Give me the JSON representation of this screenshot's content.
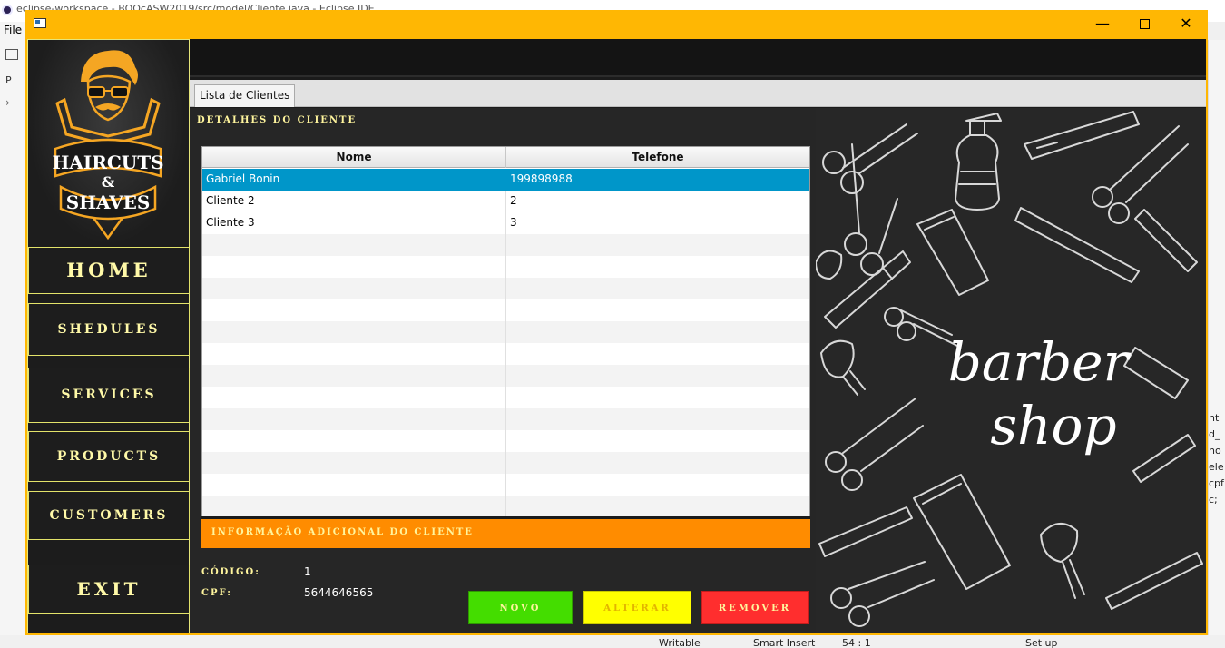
{
  "ide": {
    "title": "eclipse-workspace - BOOcASW2019/src/model/Cliente.java - Eclipse IDE",
    "menu_file": "File",
    "left_label": "P",
    "right_fragments": [
      "nt",
      "d_",
      "ho",
      "ele",
      "cpf",
      "c;"
    ],
    "status": {
      "writable": "Writable",
      "insert_mode": "Smart Insert",
      "position": "54 : 1",
      "extra": "Set up"
    }
  },
  "window": {
    "title_bar_color": "#ffb703",
    "controls": {
      "minimize": "—",
      "close": "✕"
    }
  },
  "sidebar": {
    "logo": {
      "line1": "HAIRCUTS",
      "line2": "&",
      "line3": "SHAVES"
    },
    "items": [
      {
        "label": "HOME"
      },
      {
        "label": "SHEDULES"
      },
      {
        "label": "SERVICES"
      },
      {
        "label": "PRODUCTS"
      },
      {
        "label": "CUSTOMERS"
      },
      {
        "label": "EXIT"
      }
    ]
  },
  "tabs": [
    {
      "label": "Lista de Clientes"
    }
  ],
  "details": {
    "title": "DETALHES DO CLIENTE",
    "table": {
      "columns": [
        "Nome",
        "Telefone"
      ],
      "rows": [
        {
          "nome": "Gabriel Bonin",
          "telefone": "199898988",
          "selected": true
        },
        {
          "nome": "Cliente 2",
          "telefone": "2",
          "selected": false
        },
        {
          "nome": "Cliente 3",
          "telefone": "3",
          "selected": false
        }
      ],
      "selection_color": "#0096c9"
    }
  },
  "info": {
    "title": "INFORMAÇÃO ADICIONAL DO CLIENTE",
    "header_color": "#ff8c00",
    "codigo_label": "CÓDIGO:",
    "codigo_value": "1",
    "cpf_label": "CPF:",
    "cpf_value": "5644646565"
  },
  "actions": {
    "novo": "NOVO",
    "alterar": "ALTERAR",
    "remover": "REMOVER",
    "colors": {
      "novo": "#44dd00",
      "alterar": "#ffff00",
      "remover": "#ff2e2e"
    }
  },
  "barber_image": {
    "line1": "barber",
    "line2": "shop"
  }
}
